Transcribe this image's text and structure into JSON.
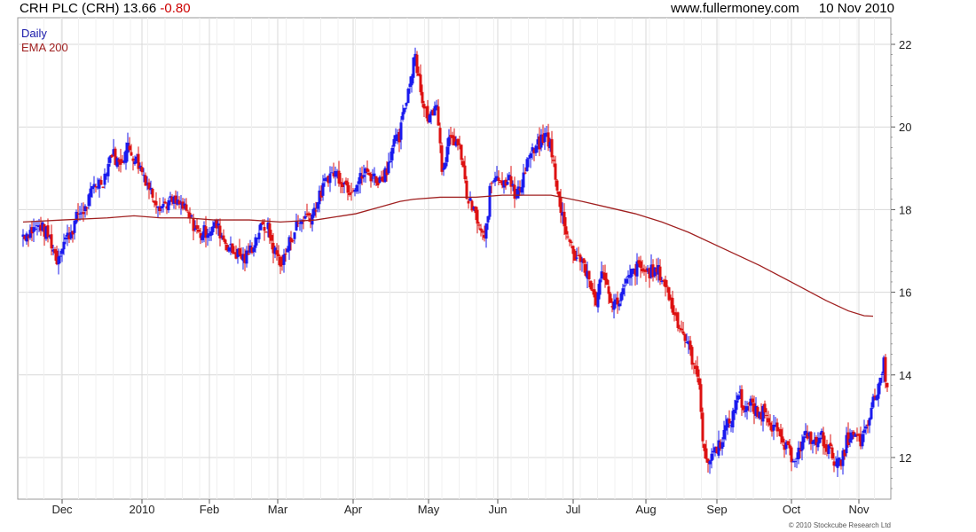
{
  "header": {
    "title": "CRH PLC (CRH) 13.66",
    "change": "-0.80",
    "source": "www.fullermoney.com",
    "date": "10 Nov 2010"
  },
  "legend": {
    "daily": "Daily",
    "ema": "EMA 200"
  },
  "footer": {
    "copyright": "© 2010 Stockcube Research Ltd"
  },
  "colors": {
    "up": "#1a1aee",
    "down": "#dd1111",
    "ema": "#a02020",
    "grid": "#d8d8d8"
  },
  "chart_data": {
    "type": "candlestick",
    "y_axis": {
      "ticks": [
        12,
        14,
        16,
        18,
        20,
        22
      ],
      "range": [
        11.2,
        22.3
      ],
      "side": "right"
    },
    "x_axis": {
      "months": [
        "Dec",
        "2010",
        "Feb",
        "Mar",
        "Apr",
        "May",
        "Jun",
        "Jul",
        "Aug",
        "Sep",
        "Oct",
        "Nov"
      ]
    },
    "grid": true,
    "legend_position": "top-left",
    "ema_200": [
      [
        0,
        17.7
      ],
      [
        45,
        17.75
      ],
      [
        95,
        17.8
      ],
      [
        125,
        17.85
      ],
      [
        155,
        17.8
      ],
      [
        185,
        17.8
      ],
      [
        215,
        17.75
      ],
      [
        255,
        17.75
      ],
      [
        290,
        17.7
      ],
      [
        330,
        17.75
      ],
      [
        375,
        17.9
      ],
      [
        400,
        18.05
      ],
      [
        425,
        18.2
      ],
      [
        440,
        18.25
      ],
      [
        470,
        18.3
      ],
      [
        510,
        18.3
      ],
      [
        540,
        18.35
      ],
      [
        568,
        18.35
      ],
      [
        595,
        18.35
      ],
      [
        630,
        18.2
      ],
      [
        660,
        18.05
      ],
      [
        690,
        17.9
      ],
      [
        720,
        17.7
      ],
      [
        750,
        17.45
      ],
      [
        790,
        17.05
      ],
      [
        830,
        16.65
      ],
      [
        870,
        16.2
      ],
      [
        905,
        15.8
      ],
      [
        930,
        15.55
      ],
      [
        948,
        15.43
      ],
      [
        958,
        15.42
      ]
    ],
    "anchors": [
      [
        0,
        17.4
      ],
      [
        10,
        17.5
      ],
      [
        20,
        17.6
      ],
      [
        30,
        17.3
      ],
      [
        38,
        16.8
      ],
      [
        45,
        17.2
      ],
      [
        55,
        17.5
      ],
      [
        62,
        17.9
      ],
      [
        70,
        18.0
      ],
      [
        80,
        18.6
      ],
      [
        90,
        18.7
      ],
      [
        100,
        19.4
      ],
      [
        108,
        19.1
      ],
      [
        118,
        19.5
      ],
      [
        125,
        19.3
      ],
      [
        135,
        18.9
      ],
      [
        145,
        18.4
      ],
      [
        155,
        18.1
      ],
      [
        168,
        18.2
      ],
      [
        178,
        18.1
      ],
      [
        188,
        17.8
      ],
      [
        198,
        17.4
      ],
      [
        208,
        17.5
      ],
      [
        218,
        17.6
      ],
      [
        226,
        17.3
      ],
      [
        235,
        17.0
      ],
      [
        244,
        16.9
      ],
      [
        250,
        16.8
      ],
      [
        258,
        17.1
      ],
      [
        266,
        17.5
      ],
      [
        275,
        17.6
      ],
      [
        283,
        17.0
      ],
      [
        292,
        16.7
      ],
      [
        300,
        17.2
      ],
      [
        308,
        17.6
      ],
      [
        316,
        17.8
      ],
      [
        326,
        17.9
      ],
      [
        334,
        18.3
      ],
      [
        343,
        18.8
      ],
      [
        352,
        18.9
      ],
      [
        360,
        18.7
      ],
      [
        368,
        18.5
      ],
      [
        378,
        18.7
      ],
      [
        386,
        18.9
      ],
      [
        394,
        18.8
      ],
      [
        402,
        18.7
      ],
      [
        410,
        19.0
      ],
      [
        417,
        19.6
      ],
      [
        424,
        19.7
      ],
      [
        430,
        20.5
      ],
      [
        437,
        21.2
      ],
      [
        441,
        21.9
      ],
      [
        446,
        21.2
      ],
      [
        452,
        20.4
      ],
      [
        458,
        20.2
      ],
      [
        466,
        20.7
      ],
      [
        472,
        19.0
      ],
      [
        480,
        19.6
      ],
      [
        487,
        19.7
      ],
      [
        494,
        19.3
      ],
      [
        500,
        18.3
      ],
      [
        507,
        18.0
      ],
      [
        514,
        17.6
      ],
      [
        520,
        17.2
      ],
      [
        527,
        18.6
      ],
      [
        534,
        18.9
      ],
      [
        541,
        18.6
      ],
      [
        548,
        18.9
      ],
      [
        555,
        18.2
      ],
      [
        562,
        18.7
      ],
      [
        570,
        19.3
      ],
      [
        576,
        19.4
      ],
      [
        582,
        19.6
      ],
      [
        590,
        19.8
      ],
      [
        596,
        19.4
      ],
      [
        602,
        18.4
      ],
      [
        610,
        17.7
      ],
      [
        616,
        17.2
      ],
      [
        622,
        16.9
      ],
      [
        630,
        16.8
      ],
      [
        638,
        16.2
      ],
      [
        646,
        15.8
      ],
      [
        654,
        16.6
      ],
      [
        660,
        15.9
      ],
      [
        668,
        15.7
      ],
      [
        676,
        16.0
      ],
      [
        684,
        16.4
      ],
      [
        692,
        16.6
      ],
      [
        700,
        16.5
      ],
      [
        708,
        16.5
      ],
      [
        716,
        16.5
      ],
      [
        724,
        16.2
      ],
      [
        732,
        15.6
      ],
      [
        740,
        15.2
      ],
      [
        748,
        14.8
      ],
      [
        754,
        14.4
      ],
      [
        758,
        14.0
      ],
      [
        762,
        13.9
      ],
      [
        766,
        12.5
      ],
      [
        770,
        11.8
      ],
      [
        776,
        12.1
      ],
      [
        784,
        12.3
      ],
      [
        792,
        12.7
      ],
      [
        800,
        13.0
      ],
      [
        806,
        13.6
      ],
      [
        812,
        13.2
      ],
      [
        820,
        13.3
      ],
      [
        828,
        13.0
      ],
      [
        836,
        13.2
      ],
      [
        844,
        12.8
      ],
      [
        852,
        12.5
      ],
      [
        860,
        12.2
      ],
      [
        868,
        12.0
      ],
      [
        876,
        12.2
      ],
      [
        884,
        12.6
      ],
      [
        892,
        12.3
      ],
      [
        900,
        12.5
      ],
      [
        908,
        12.2
      ],
      [
        916,
        11.9
      ],
      [
        922,
        11.8
      ],
      [
        928,
        12.4
      ],
      [
        936,
        12.5
      ],
      [
        944,
        12.4
      ],
      [
        950,
        12.6
      ],
      [
        956,
        13.2
      ],
      [
        962,
        13.6
      ],
      [
        966,
        13.9
      ],
      [
        970,
        14.3
      ],
      [
        974,
        13.7
      ]
    ]
  }
}
